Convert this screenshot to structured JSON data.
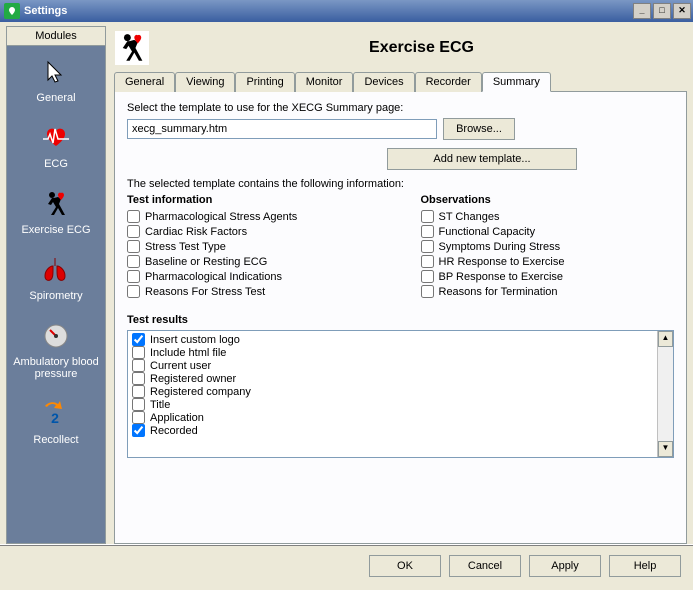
{
  "window": {
    "title": "Settings"
  },
  "sidebar": {
    "header": "Modules",
    "items": [
      {
        "label": "General"
      },
      {
        "label": "ECG"
      },
      {
        "label": "Exercise ECG"
      },
      {
        "label": "Spirometry"
      },
      {
        "label": "Ambulatory blood pressure"
      },
      {
        "label": "Recollect"
      }
    ]
  },
  "page": {
    "title": "Exercise ECG"
  },
  "tabs": {
    "items": [
      {
        "label": "General"
      },
      {
        "label": "Viewing"
      },
      {
        "label": "Printing"
      },
      {
        "label": "Monitor"
      },
      {
        "label": "Devices"
      },
      {
        "label": "Recorder"
      },
      {
        "label": "Summary"
      }
    ],
    "active_index": 6
  },
  "summary": {
    "select_template_label": "Select the template to use for the XECG Summary page:",
    "template_value": "xecg_summary.htm",
    "browse_label": "Browse...",
    "add_template_label": "Add new template...",
    "contains_label": "The selected template contains the following information:",
    "test_info_header": "Test information",
    "observations_header": "Observations",
    "test_results_header": "Test results",
    "test_info": [
      {
        "label": "Pharmacological Stress Agents",
        "checked": false
      },
      {
        "label": "Cardiac Risk Factors",
        "checked": false
      },
      {
        "label": "Stress Test Type",
        "checked": false
      },
      {
        "label": "Baseline or Resting ECG",
        "checked": false
      },
      {
        "label": "Pharmacological Indications",
        "checked": false
      },
      {
        "label": "Reasons For Stress Test",
        "checked": false
      }
    ],
    "observations": [
      {
        "label": "ST Changes",
        "checked": false
      },
      {
        "label": "Functional Capacity",
        "checked": false
      },
      {
        "label": "Symptoms During Stress",
        "checked": false
      },
      {
        "label": "HR Response to Exercise",
        "checked": false
      },
      {
        "label": "BP Response to Exercise",
        "checked": false
      },
      {
        "label": "Reasons for Termination",
        "checked": false
      }
    ],
    "test_results": [
      {
        "label": "Insert custom logo",
        "checked": true
      },
      {
        "label": "Include html file",
        "checked": false
      },
      {
        "label": "Current user",
        "checked": false
      },
      {
        "label": "Registered owner",
        "checked": false
      },
      {
        "label": "Registered company",
        "checked": false
      },
      {
        "label": "Title",
        "checked": false
      },
      {
        "label": "Application",
        "checked": false
      },
      {
        "label": "Recorded",
        "checked": true
      }
    ]
  },
  "dialog_buttons": {
    "ok": "OK",
    "cancel": "Cancel",
    "apply": "Apply",
    "help": "Help"
  }
}
